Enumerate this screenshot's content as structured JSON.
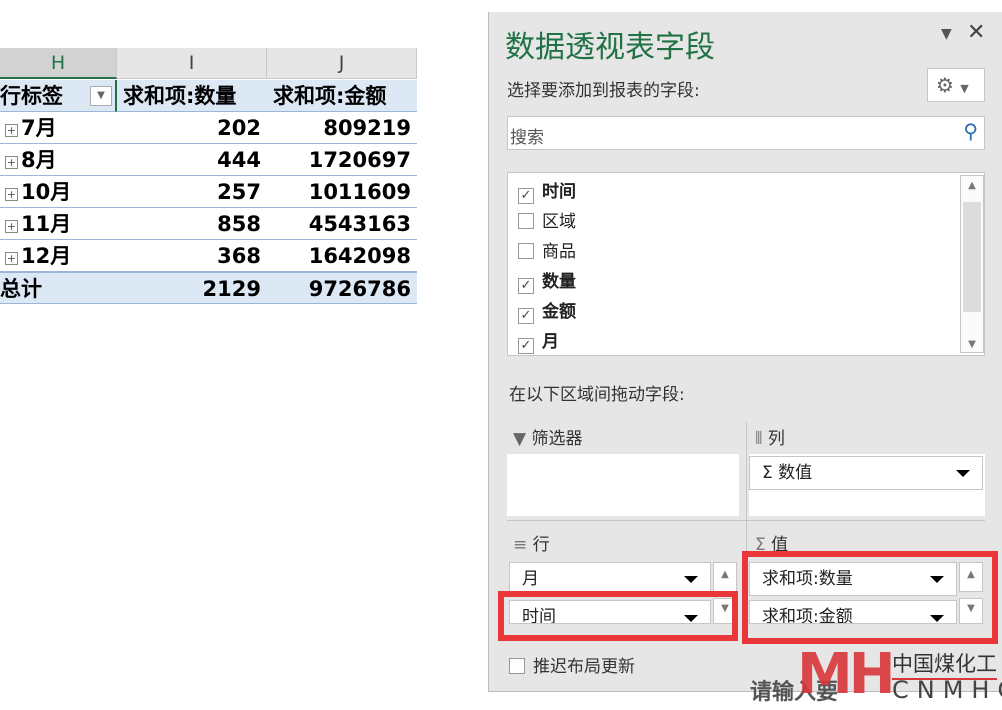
{
  "sheet": {
    "columns": [
      "H",
      "I",
      "J"
    ],
    "headers": [
      "行标签",
      "求和项:数量",
      "求和项:金额"
    ],
    "rows": [
      {
        "label": "7月",
        "qty": "202",
        "amount": "809219"
      },
      {
        "label": "8月",
        "qty": "444",
        "amount": "1720697"
      },
      {
        "label": "10月",
        "qty": "257",
        "amount": "1011609"
      },
      {
        "label": "11月",
        "qty": "858",
        "amount": "4543163"
      },
      {
        "label": "12月",
        "qty": "368",
        "amount": "1642098"
      }
    ],
    "total": {
      "label": "总计",
      "qty": "2129",
      "amount": "9726786"
    }
  },
  "panel": {
    "title": "数据透视表字段",
    "subtitle": "选择要添加到报表的字段:",
    "search_placeholder": "搜索",
    "fields": [
      {
        "name": "时间",
        "checked": true
      },
      {
        "name": "区域",
        "checked": false
      },
      {
        "name": "商品",
        "checked": false
      },
      {
        "name": "数量",
        "checked": true
      },
      {
        "name": "金额",
        "checked": true
      },
      {
        "name": "月",
        "checked": true
      }
    ],
    "drag_label": "在以下区域间拖动字段:",
    "filter_label": "筛选器",
    "columns_label": "列",
    "columns_items": [
      "Σ 数值"
    ],
    "rows_label": "行",
    "rows_items": [
      "月",
      "时间"
    ],
    "values_label": "值",
    "values_items": [
      "求和项:数量",
      "求和项:金额"
    ],
    "defer_label": "推迟布局更新"
  },
  "watermark": {
    "text_cn": "中国煤化工",
    "text_en": "CNMHG",
    "logo": "MH",
    "overlay": "请输入要"
  },
  "colors": {
    "accent": "#217346",
    "highlight": "#e8363b"
  }
}
